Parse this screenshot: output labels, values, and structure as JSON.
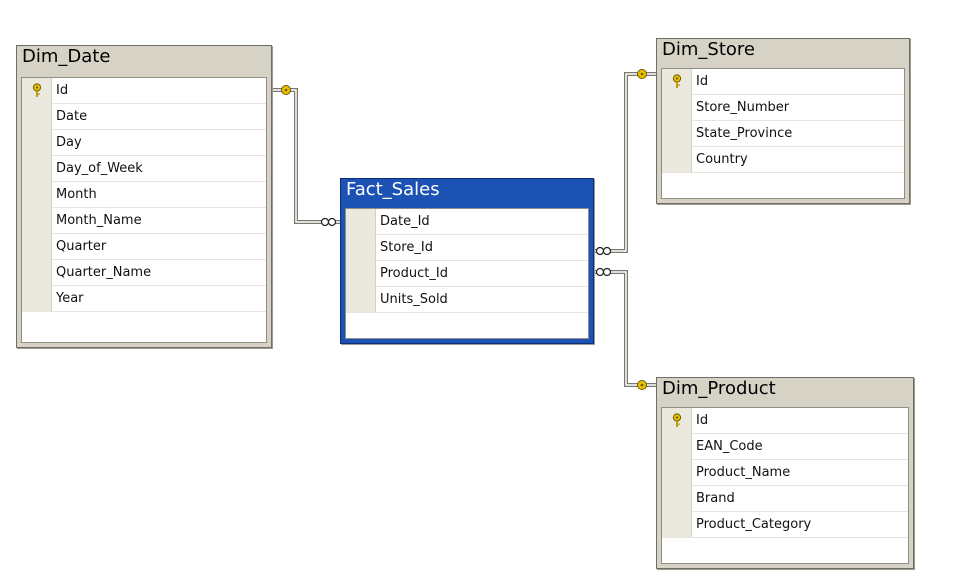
{
  "tables": {
    "dim_date": {
      "title": "Dim_Date",
      "key_column": "Id",
      "columns": [
        "Id",
        "Date",
        "Day",
        "Day_of_Week",
        "Month",
        "Month_Name",
        "Quarter",
        "Quarter_Name",
        "Year"
      ]
    },
    "fact_sales": {
      "title": "Fact_Sales",
      "columns": [
        "Date_Id",
        "Store_Id",
        "Product_Id",
        "Units_Sold"
      ]
    },
    "dim_store": {
      "title": "Dim_Store",
      "key_column": "Id",
      "columns": [
        "Id",
        "Store_Number",
        "State_Province",
        "Country"
      ]
    },
    "dim_product": {
      "title": "Dim_Product",
      "key_column": "Id",
      "columns": [
        "Id",
        "EAN_Code",
        "Product_Name",
        "Brand",
        "Product_Category"
      ]
    }
  },
  "relationships": [
    {
      "from": "fact_sales",
      "from_column": "Date_Id",
      "to": "dim_date",
      "to_column": "Id"
    },
    {
      "from": "fact_sales",
      "from_column": "Store_Id",
      "to": "dim_store",
      "to_column": "Id"
    },
    {
      "from": "fact_sales",
      "from_column": "Product_Id",
      "to": "dim_product",
      "to_column": "Id"
    }
  ],
  "colors": {
    "selected_title_bg": "#1c52b4",
    "table_frame": "#d6d3c6",
    "key_icon": "#e8c200",
    "connector": "#7a786e"
  },
  "icons": {
    "primary_key": "key-icon",
    "one_end": "key-endpoint-icon",
    "many_end": "infinity-endpoint-icon"
  }
}
